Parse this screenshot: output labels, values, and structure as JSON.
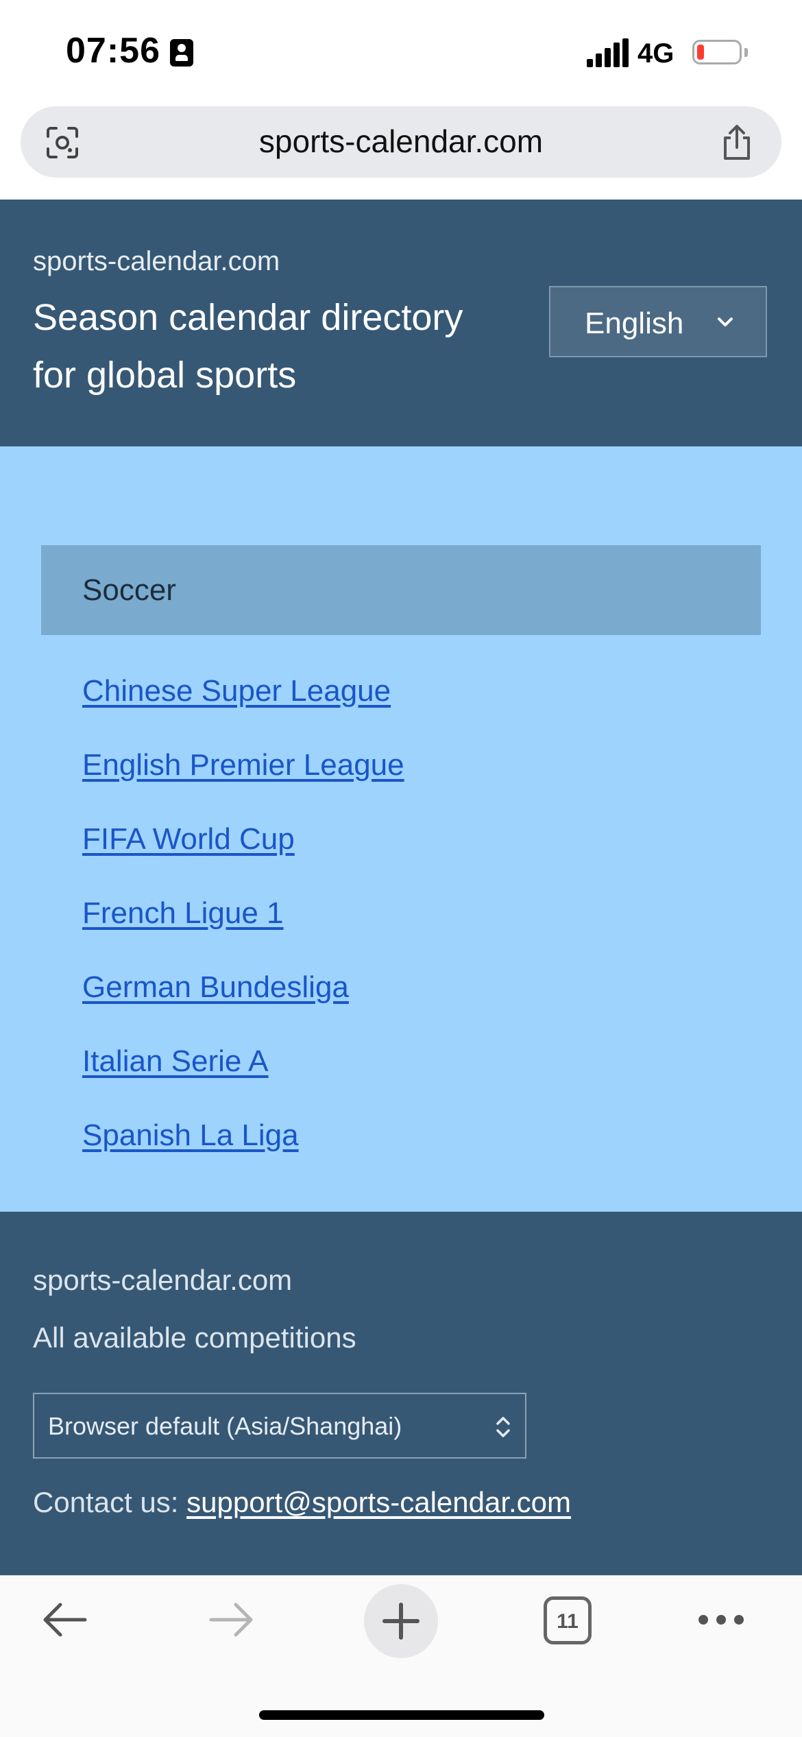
{
  "status_bar": {
    "time": "07:56",
    "network": "4G",
    "battery_color": "#ff3b30"
  },
  "browser": {
    "url": "sports-calendar.com",
    "tab_count": "11"
  },
  "header": {
    "brand": "sports-calendar.com",
    "tagline": "Season calendar directory for global sports",
    "language": "English"
  },
  "main": {
    "category": "Soccer",
    "leagues": [
      "Chinese Super League",
      "English Premier League",
      "FIFA World Cup",
      "French Ligue 1",
      "German Bundesliga",
      "Italian Serie A",
      "Spanish La Liga"
    ]
  },
  "footer": {
    "brand": "sports-calendar.com",
    "subtitle": "All available competitions",
    "timezone": "Browser default (Asia/Shanghai)",
    "contact_label": "Contact us:",
    "contact_email": "support@sports-calendar.com"
  },
  "colors": {
    "header_bg": "#375874",
    "main_bg": "#9dd3fd",
    "category_bg": "#7aaace",
    "link": "#1a55c8"
  },
  "icons": {
    "lens": "camera-lens-icon",
    "share": "share-icon",
    "lang": "chevron-down-icon",
    "tz": "updown-arrows-icon",
    "back": "back-arrow-icon",
    "forward": "forward-arrow-icon",
    "new_tab": "plus-icon",
    "tabs": "tabs-icon",
    "more": "more-dots-icon"
  }
}
